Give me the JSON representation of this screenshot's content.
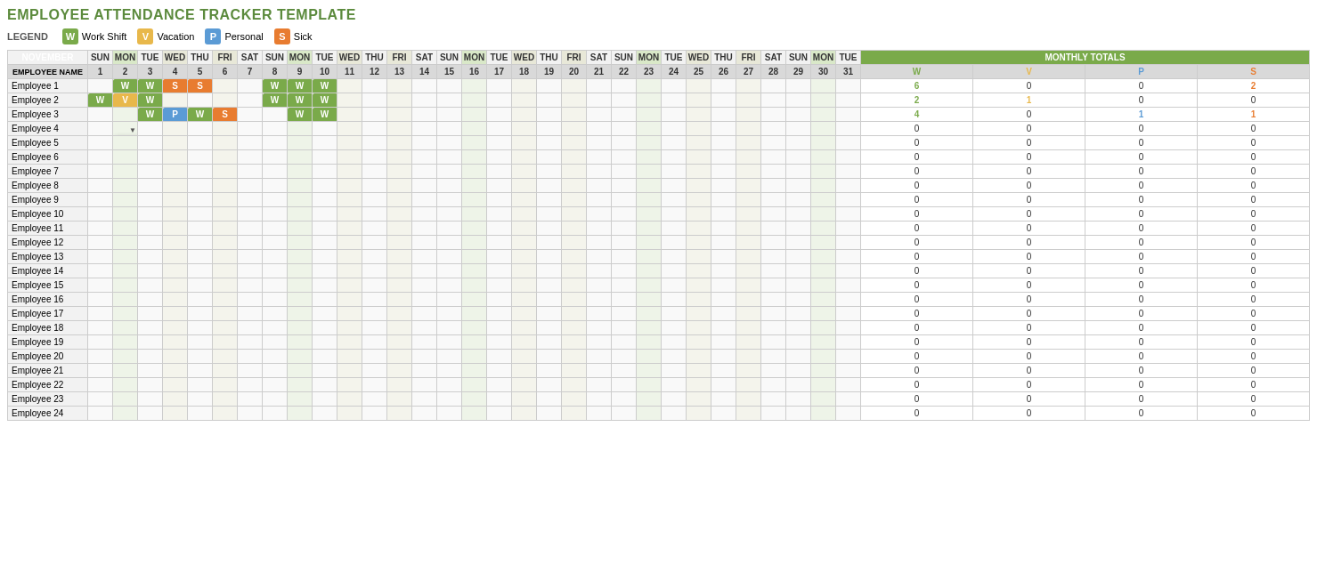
{
  "title": "EMPLOYEE ATTENDANCE TRACKER TEMPLATE",
  "legend": {
    "label": "LEGEND",
    "items": [
      {
        "key": "W",
        "label": "Work Shift",
        "class": "badge-w"
      },
      {
        "key": "V",
        "label": "Vacation",
        "class": "badge-v"
      },
      {
        "key": "P",
        "label": "Personal",
        "class": "badge-p"
      },
      {
        "key": "S",
        "label": "Sick",
        "class": "badge-s"
      }
    ]
  },
  "month": "NOVEMBER",
  "monthly_totals_label": "MONTHLY TOTALS",
  "col_headers": {
    "employee_name": "EMPLOYEE NAME",
    "totals": [
      "W",
      "V",
      "P",
      "S"
    ]
  },
  "week_days": [
    "SUN",
    "MON",
    "TUE",
    "WED",
    "THU",
    "FRI",
    "SAT"
  ],
  "day_numbers": [
    1,
    2,
    3,
    4,
    5,
    6,
    7,
    8,
    9,
    10,
    11,
    12,
    13,
    14,
    15,
    16,
    17,
    18,
    19,
    20,
    21,
    22,
    23,
    24,
    25,
    26,
    27,
    28,
    29,
    30,
    31
  ],
  "employees": [
    {
      "name": "Employee 1",
      "days": {
        "2": "w",
        "3": "w",
        "4": "s",
        "5": "s",
        "8": "w",
        "9": "w",
        "10": "w"
      },
      "totals": {
        "w": 6,
        "v": 0,
        "p": 0,
        "s": 2
      }
    },
    {
      "name": "Employee 2",
      "days": {
        "1": "w",
        "2": "v",
        "3": "w",
        "8": "w",
        "9": "w",
        "10": "w"
      },
      "totals": {
        "w": 2,
        "v": 1,
        "p": 0,
        "s": 0
      }
    },
    {
      "name": "Employee 3",
      "days": {
        "3": "w",
        "4": "p",
        "5": "w",
        "6": "s",
        "9": "w",
        "10": "w"
      },
      "totals": {
        "w": 4,
        "v": 0,
        "p": 1,
        "s": 1
      }
    },
    {
      "name": "Employee 4",
      "days": {},
      "totals": {
        "w": 0,
        "v": 0,
        "p": 0,
        "s": 0
      },
      "dropdown": true,
      "dropdown_cell": "2"
    },
    {
      "name": "Employee 5",
      "days": {},
      "totals": {
        "w": 0,
        "v": 0,
        "p": 0,
        "s": 0
      }
    },
    {
      "name": "Employee 6",
      "days": {},
      "totals": {
        "w": 0,
        "v": 0,
        "p": 0,
        "s": 0
      }
    },
    {
      "name": "Employee 7",
      "days": {},
      "totals": {
        "w": 0,
        "v": 0,
        "p": 0,
        "s": 0
      }
    },
    {
      "name": "Employee 8",
      "days": {},
      "totals": {
        "w": 0,
        "v": 0,
        "p": 0,
        "s": 0
      }
    },
    {
      "name": "Employee 9",
      "days": {},
      "totals": {
        "w": 0,
        "v": 0,
        "p": 0,
        "s": 0
      }
    },
    {
      "name": "Employee 10",
      "days": {},
      "totals": {
        "w": 0,
        "v": 0,
        "p": 0,
        "s": 0
      }
    },
    {
      "name": "Employee 11",
      "days": {},
      "totals": {
        "w": 0,
        "v": 0,
        "p": 0,
        "s": 0
      }
    },
    {
      "name": "Employee 12",
      "days": {},
      "totals": {
        "w": 0,
        "v": 0,
        "p": 0,
        "s": 0
      }
    },
    {
      "name": "Employee 13",
      "days": {},
      "totals": {
        "w": 0,
        "v": 0,
        "p": 0,
        "s": 0
      }
    },
    {
      "name": "Employee 14",
      "days": {},
      "totals": {
        "w": 0,
        "v": 0,
        "p": 0,
        "s": 0
      }
    },
    {
      "name": "Employee 15",
      "days": {},
      "totals": {
        "w": 0,
        "v": 0,
        "p": 0,
        "s": 0
      }
    },
    {
      "name": "Employee 16",
      "days": {},
      "totals": {
        "w": 0,
        "v": 0,
        "p": 0,
        "s": 0
      }
    },
    {
      "name": "Employee 17",
      "days": {},
      "totals": {
        "w": 0,
        "v": 0,
        "p": 0,
        "s": 0
      }
    },
    {
      "name": "Employee 18",
      "days": {},
      "totals": {
        "w": 0,
        "v": 0,
        "p": 0,
        "s": 0
      }
    },
    {
      "name": "Employee 19",
      "days": {},
      "totals": {
        "w": 0,
        "v": 0,
        "p": 0,
        "s": 0
      }
    },
    {
      "name": "Employee 20",
      "days": {},
      "totals": {
        "w": 0,
        "v": 0,
        "p": 0,
        "s": 0
      }
    },
    {
      "name": "Employee 21",
      "days": {},
      "totals": {
        "w": 0,
        "v": 0,
        "p": 0,
        "s": 0
      }
    },
    {
      "name": "Employee 22",
      "days": {},
      "totals": {
        "w": 0,
        "v": 0,
        "p": 0,
        "s": 0
      }
    },
    {
      "name": "Employee 23",
      "days": {},
      "totals": {
        "w": 0,
        "v": 0,
        "p": 0,
        "s": 0
      }
    },
    {
      "name": "Employee 24",
      "days": {},
      "totals": {
        "w": 0,
        "v": 0,
        "p": 0,
        "s": 0
      }
    }
  ],
  "dropdown_options": [
    "W",
    "V",
    "P",
    "S"
  ]
}
